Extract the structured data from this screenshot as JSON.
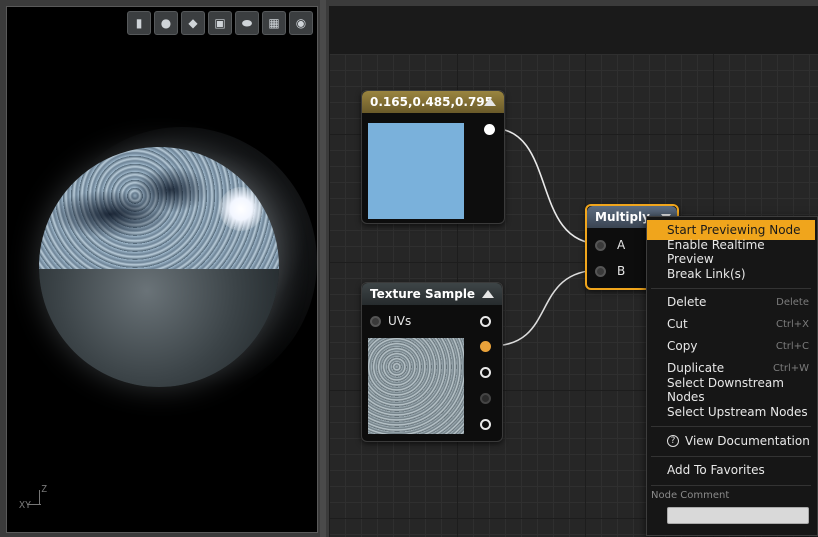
{
  "viewport": {
    "toolbar_icons": [
      "cylinder-icon",
      "sphere-icon",
      "plane-icon",
      "cube-icon",
      "teapot-icon",
      "grid-icon",
      "realtime-icon"
    ],
    "axis": {
      "z": "Z",
      "xy": "XY"
    }
  },
  "nodes": {
    "constant": {
      "title": "0.165,0.485,0.795",
      "color": "#7ab1db",
      "header_color": "#7d6d35"
    },
    "texture": {
      "title": "Texture Sample",
      "pin_uvs": "UVs",
      "header_color": "#2f3537"
    },
    "multiply": {
      "title": "Multiply",
      "pin_a": "A",
      "pin_b": "B",
      "header_color": "#4f5d6e",
      "selected_color": "#f0a51c"
    }
  },
  "context_menu": {
    "items": [
      {
        "label": "Start Previewing Node",
        "shortcut": ""
      },
      {
        "label": "Enable Realtime Preview",
        "shortcut": ""
      },
      {
        "label": "Break Link(s)",
        "shortcut": ""
      },
      {
        "label": "Delete",
        "shortcut": "Delete"
      },
      {
        "label": "Cut",
        "shortcut": "Ctrl+X"
      },
      {
        "label": "Copy",
        "shortcut": "Ctrl+C"
      },
      {
        "label": "Duplicate",
        "shortcut": "Ctrl+W"
      },
      {
        "label": "Select Downstream Nodes",
        "shortcut": ""
      },
      {
        "label": "Select Upstream Nodes",
        "shortcut": ""
      },
      {
        "label": "View Documentation",
        "shortcut": ""
      },
      {
        "label": "Add To Favorites",
        "shortcut": ""
      }
    ],
    "section_node_comment": "Node Comment",
    "comment_value": ""
  }
}
